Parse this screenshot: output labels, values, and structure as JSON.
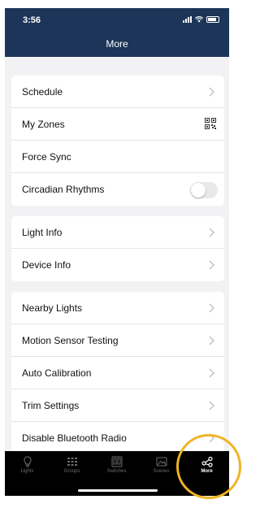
{
  "status": {
    "time": "3:56"
  },
  "header": {
    "title": "More"
  },
  "groups": [
    {
      "items": [
        {
          "label": "Schedule",
          "accessory": "chevron"
        },
        {
          "label": "My Zones",
          "accessory": "qr-code"
        },
        {
          "label": "Force Sync",
          "accessory": "none"
        },
        {
          "label": "Circadian Rhythms",
          "accessory": "toggle",
          "toggle_on": false
        }
      ]
    },
    {
      "items": [
        {
          "label": "Light Info",
          "accessory": "chevron"
        },
        {
          "label": "Device Info",
          "accessory": "chevron"
        }
      ]
    },
    {
      "items": [
        {
          "label": "Nearby Lights",
          "accessory": "chevron"
        },
        {
          "label": "Motion Sensor Testing",
          "accessory": "chevron"
        },
        {
          "label": "Auto Calibration",
          "accessory": "chevron"
        },
        {
          "label": "Trim Settings",
          "accessory": "chevron"
        },
        {
          "label": "Disable Bluetooth Radio",
          "accessory": "chevron"
        }
      ]
    }
  ],
  "tabs": [
    {
      "label": "Lights",
      "icon": "lightbulb-icon",
      "active": false
    },
    {
      "label": "Groups",
      "icon": "groups-icon",
      "active": false
    },
    {
      "label": "Switches",
      "icon": "switches-icon",
      "active": false
    },
    {
      "label": "Scenes",
      "icon": "scenes-icon",
      "active": false
    },
    {
      "label": "More",
      "icon": "share-icon",
      "active": true
    }
  ],
  "colors": {
    "header_bg": "#1c3559",
    "tabbar_bg": "#000000",
    "highlight": "#f0b323",
    "toggle_off": "#e9e9ec"
  }
}
